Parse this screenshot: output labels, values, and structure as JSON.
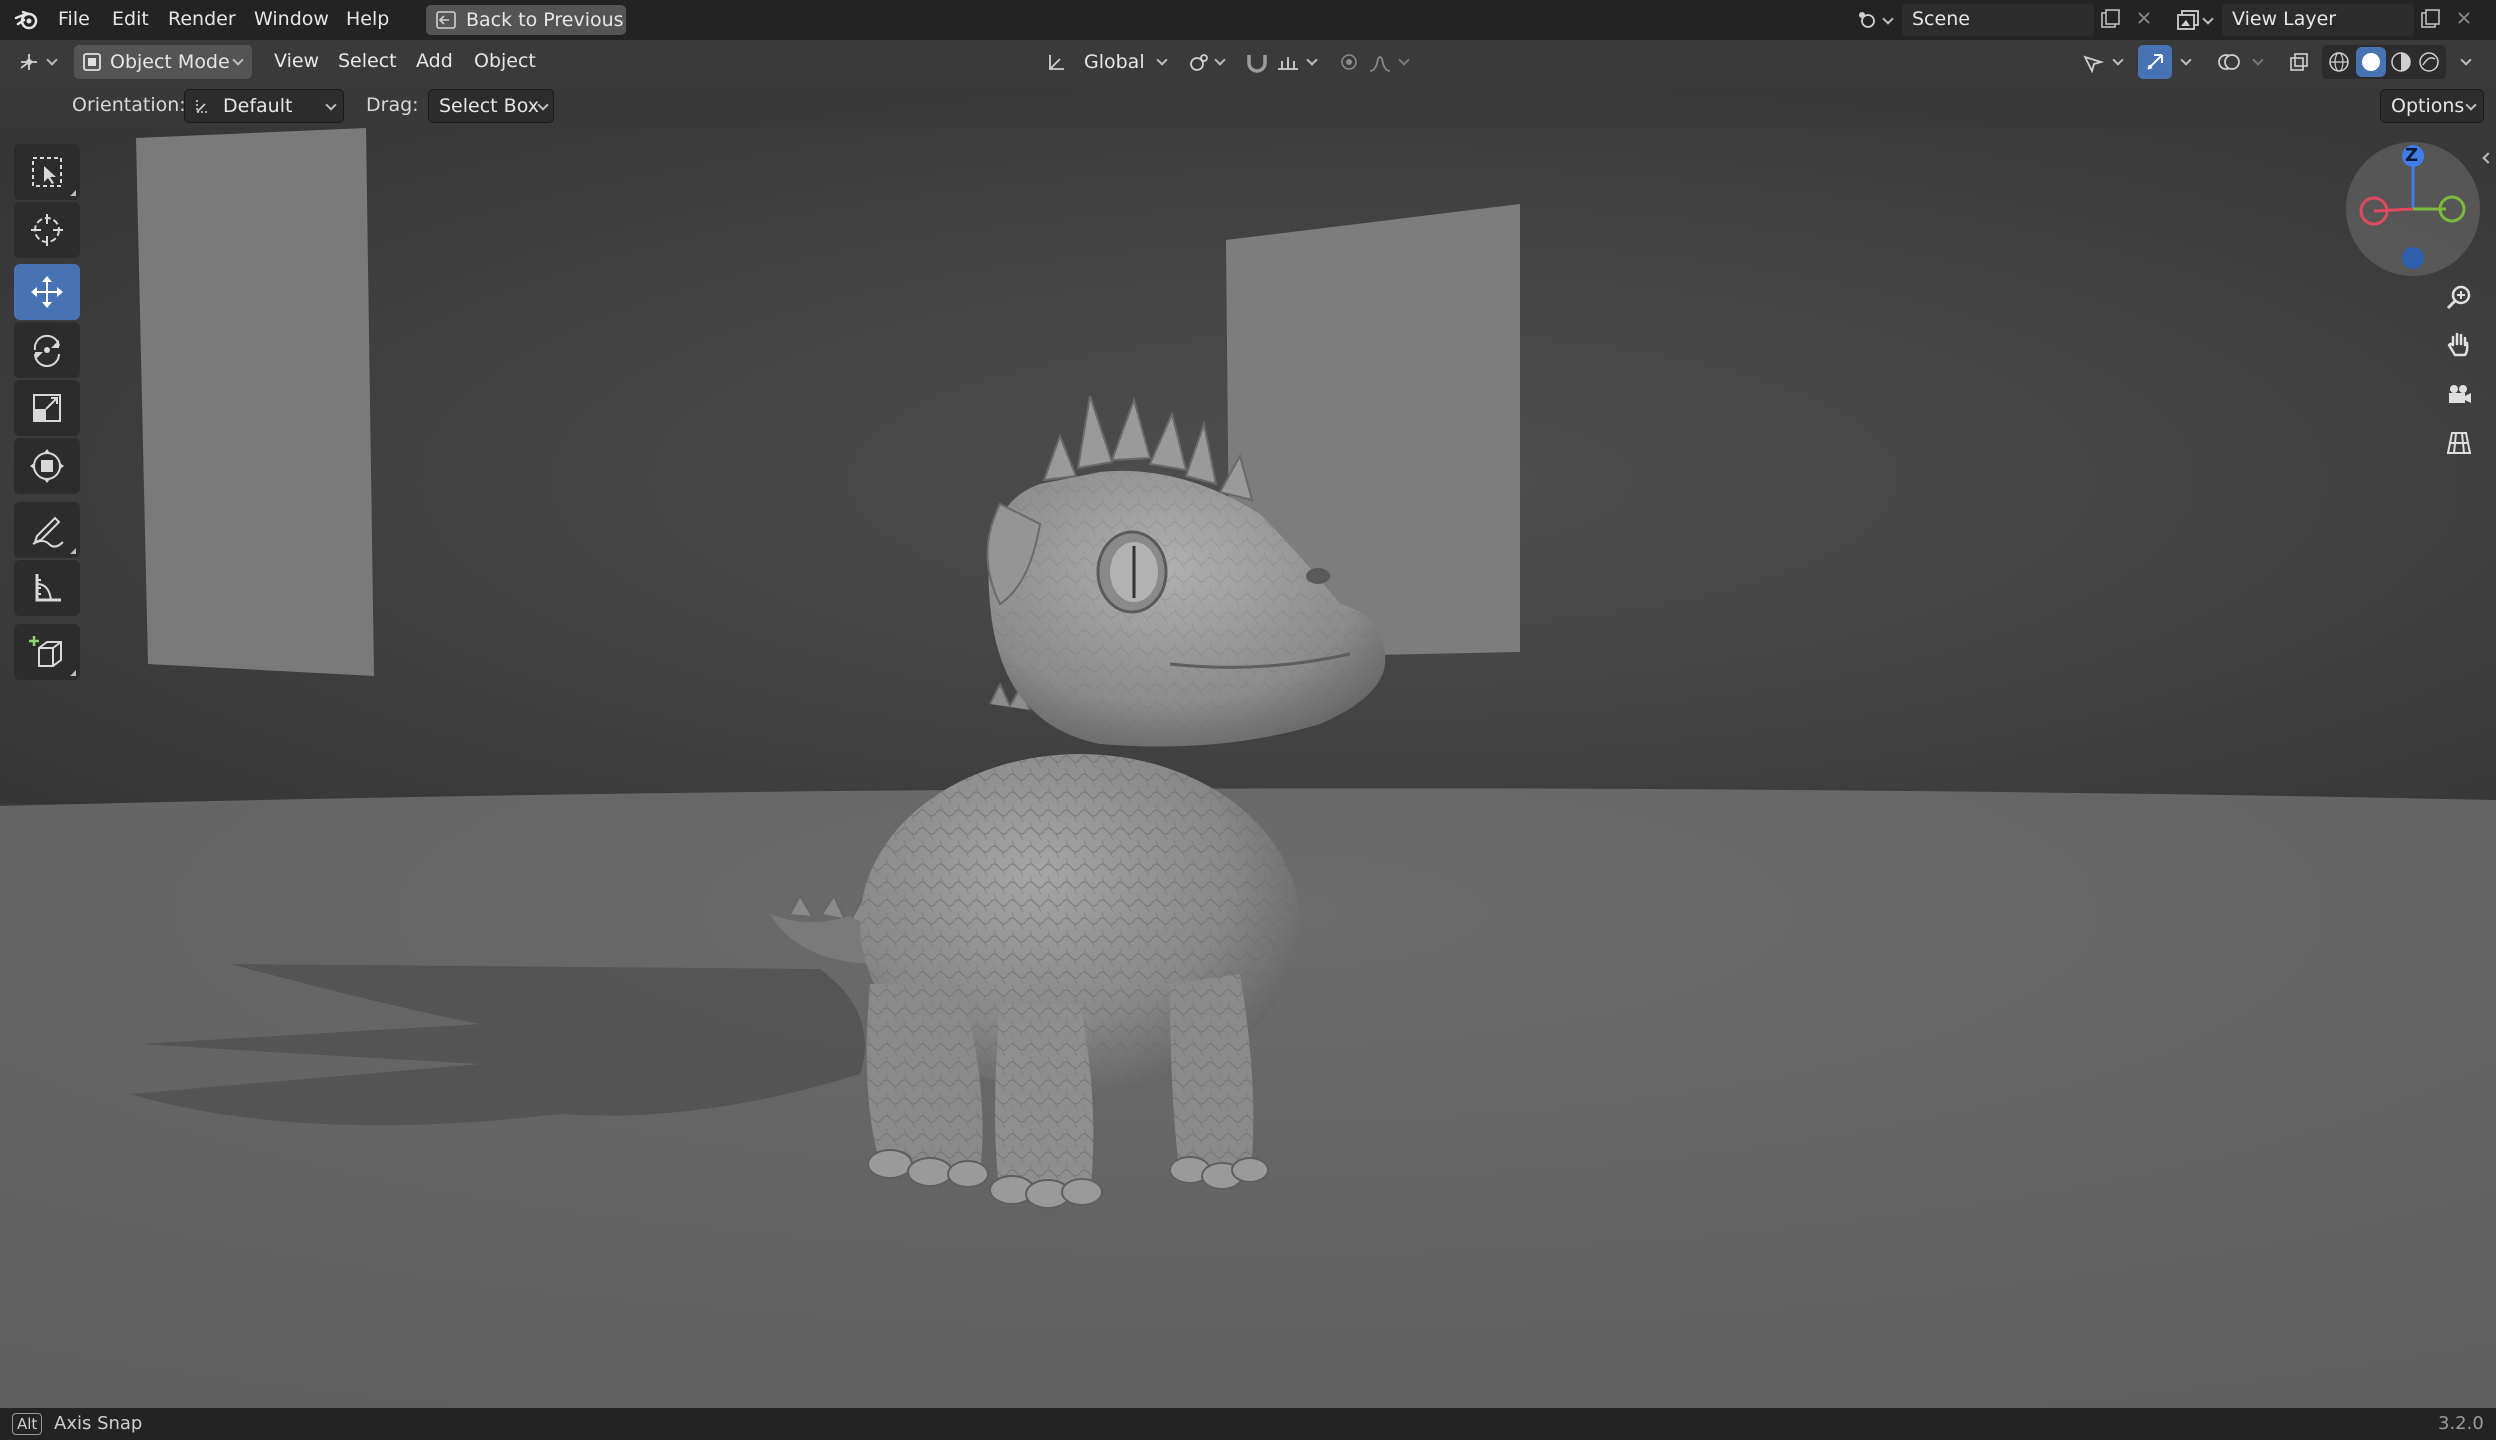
{
  "topbar": {
    "menu": [
      "File",
      "Edit",
      "Render",
      "Window",
      "Help"
    ],
    "back_button": "Back to Previous",
    "scene_label": "Scene",
    "view_layer_label": "View Layer"
  },
  "header": {
    "mode": "Object Mode",
    "menus": [
      "View",
      "Select",
      "Add",
      "Object"
    ],
    "transform_orientation": "Global"
  },
  "tool_settings": {
    "orientation_label": "Orientation:",
    "orientation_value": "Default",
    "drag_label": "Drag:",
    "drag_value": "Select Box",
    "options_label": "Options"
  },
  "toolbar": {
    "tools": [
      {
        "name": "select-box-tool",
        "icon": "select-box-icon",
        "active": false
      },
      {
        "name": "cursor-tool",
        "icon": "cursor-icon",
        "active": false
      },
      {
        "name": "move-tool",
        "icon": "move-icon",
        "active": true
      },
      {
        "name": "rotate-tool",
        "icon": "rotate-icon",
        "active": false
      },
      {
        "name": "scale-tool",
        "icon": "scale-icon",
        "active": false
      },
      {
        "name": "transform-tool",
        "icon": "transform-icon",
        "active": false
      },
      {
        "name": "annotate-tool",
        "icon": "annotate-icon",
        "active": false
      },
      {
        "name": "measure-tool",
        "icon": "measure-icon",
        "active": false
      },
      {
        "name": "add-cube-tool",
        "icon": "add-cube-icon",
        "active": false
      }
    ]
  },
  "gizmo": {
    "z_label": "Z",
    "x_color": "#e04a5c",
    "y_color": "#7cba3b",
    "z_color": "#3d7ee8"
  },
  "statusbar": {
    "key": "Alt",
    "hint": "Axis Snap",
    "version": "3.2.0"
  },
  "colors": {
    "active_tool": "#4772b3",
    "topbar_bg": "#232323",
    "header_bg": "#3a3a3a"
  }
}
